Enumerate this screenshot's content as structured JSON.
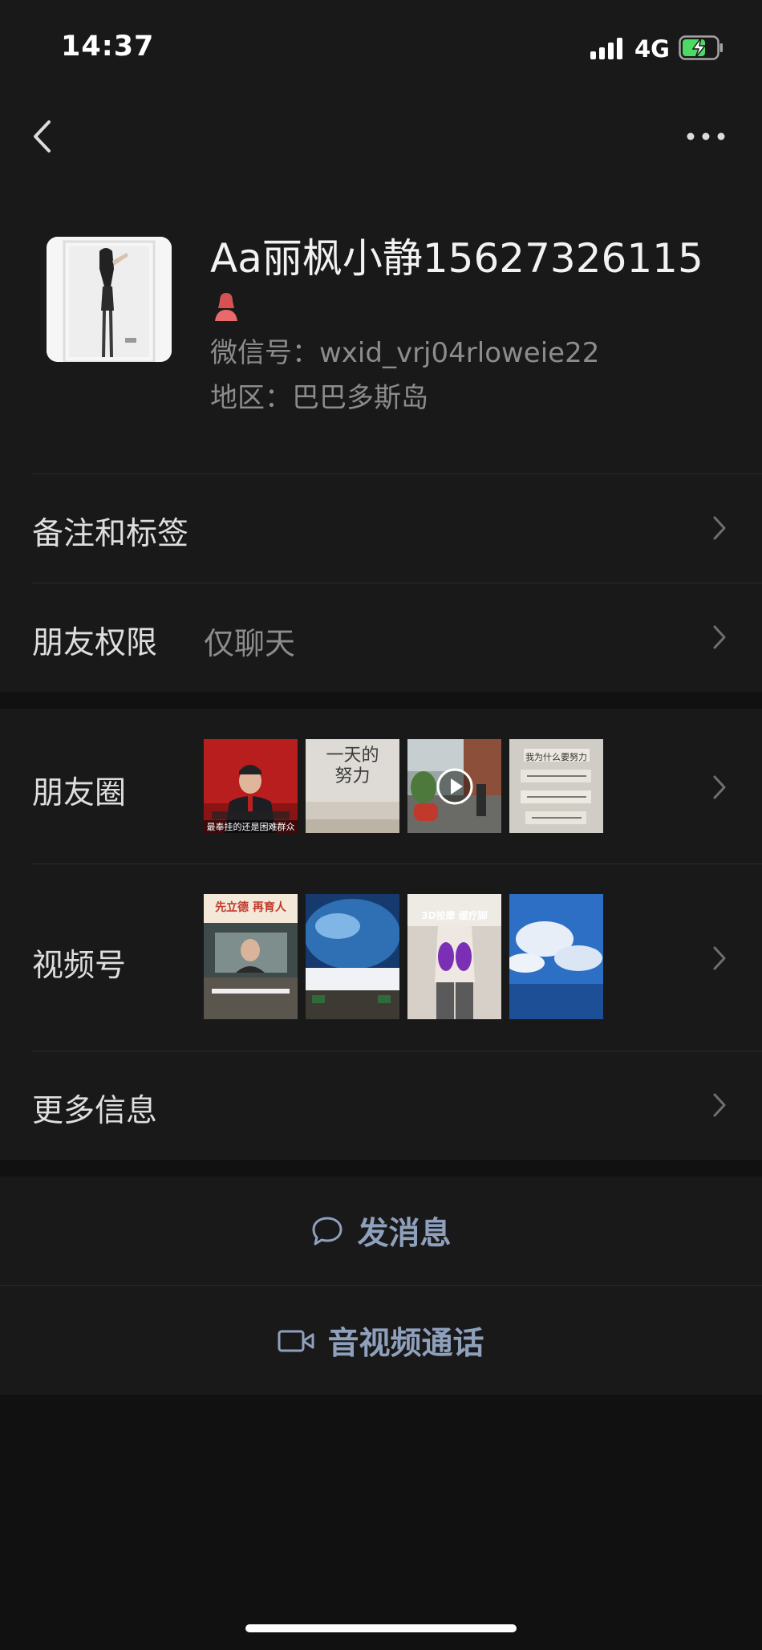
{
  "status_bar": {
    "time": "14:37",
    "network": "4G"
  },
  "profile": {
    "nickname": "Aa丽枫小静15627326115",
    "wechat_id": "微信号：wxid_vrj04rloweie22",
    "region": "地区：巴巴多斯岛",
    "gender_icon": "female-icon"
  },
  "rows": {
    "remark": {
      "label": "备注和标签"
    },
    "permission": {
      "label": "朋友权限",
      "value": "仅聊天"
    },
    "moments": {
      "label": "朋友圈",
      "thumb_captions": [
        "最奉挂的还是困难群众",
        "一天的努力",
        "",
        "我为什么要努力"
      ]
    },
    "channels": {
      "label": "视频号",
      "thumb_captions": [
        "先立德 再育人",
        "",
        "3D按摩 缓疗脚"
      ]
    },
    "more": {
      "label": "更多信息"
    }
  },
  "actions": {
    "message": "发消息",
    "call": "音视频通话"
  },
  "colors": {
    "background": "#111111",
    "surface": "#191919",
    "link_blue": "#8fa0bd",
    "secondary_text": "#8c8c8c"
  }
}
